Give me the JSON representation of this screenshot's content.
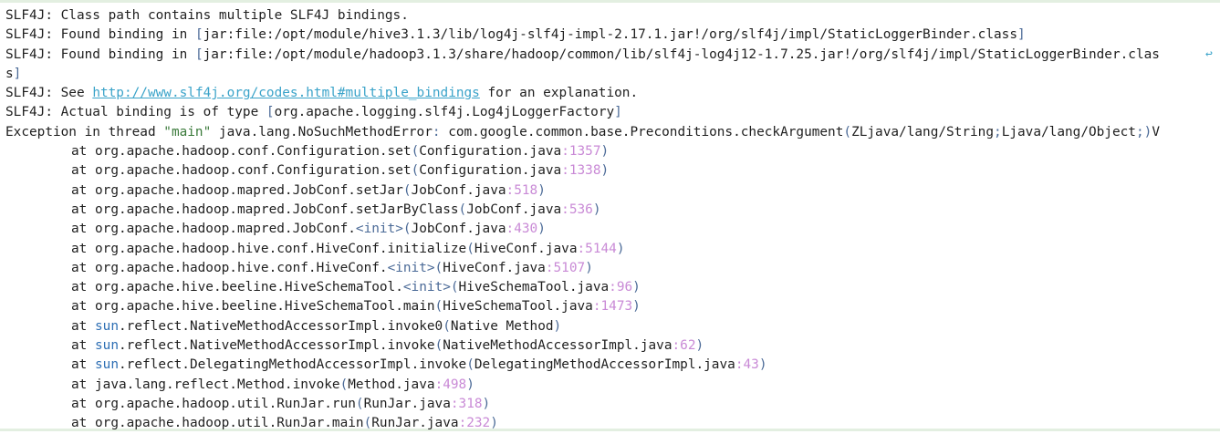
{
  "console": {
    "lines": [
      {
        "segments": [
          {
            "t": "SLF4J: Class path contains multiple SLF4J bindings.",
            "c": ""
          }
        ]
      },
      {
        "segments": [
          {
            "t": "SLF4J: Found binding in ",
            "c": ""
          },
          {
            "t": "[",
            "c": "c-dim"
          },
          {
            "t": "jar:file:/opt/module/hive3.1.3/lib/log4j-slf4j-impl-2.17.1.jar!/org/slf4j/impl/StaticLoggerBinder.class",
            "c": ""
          },
          {
            "t": "]",
            "c": "c-dim"
          }
        ]
      },
      {
        "segments": [
          {
            "t": "SLF4J: Found binding in ",
            "c": ""
          },
          {
            "t": "[",
            "c": "c-dim"
          },
          {
            "t": "jar:file:/opt/module/hadoop3.1.3/share/hadoop/common/lib/slf4j-log4j12-1.7.25.jar!/org/slf4j/impl/StaticLoggerBinder.clas",
            "c": ""
          }
        ]
      },
      {
        "segments": [
          {
            "t": "s",
            "c": ""
          },
          {
            "t": "]",
            "c": "c-dim"
          }
        ]
      },
      {
        "segments": [
          {
            "t": "SLF4J: See ",
            "c": ""
          },
          {
            "t": "http://www.slf4j.org/codes.html#multiple_bindings",
            "c": "c-link"
          },
          {
            "t": " for an explanation.",
            "c": ""
          }
        ]
      },
      {
        "segments": [
          {
            "t": "SLF4J: Actual binding is of type ",
            "c": ""
          },
          {
            "t": "[",
            "c": "c-dim"
          },
          {
            "t": "org.apache.logging.slf4j.Log4jLoggerFactory",
            "c": ""
          },
          {
            "t": "]",
            "c": "c-dim"
          }
        ]
      },
      {
        "segments": [
          {
            "t": "Exception in thread ",
            "c": ""
          },
          {
            "t": "\"main\"",
            "c": "c-str"
          },
          {
            "t": " java.lang.NoSuchMethodError",
            "c": ""
          },
          {
            "t": ":",
            "c": "c-dim"
          },
          {
            "t": " com.google.common.base.Preconditions.checkArgument",
            "c": ""
          },
          {
            "t": "(",
            "c": "c-dim"
          },
          {
            "t": "ZLjava/lang/String",
            "c": ""
          },
          {
            "t": ";",
            "c": "c-dim"
          },
          {
            "t": "Ljava/lang/Object",
            "c": ""
          },
          {
            "t": ";",
            "c": "c-dim"
          },
          {
            "t": ")",
            "c": "c-dim"
          },
          {
            "t": "V",
            "c": ""
          }
        ]
      },
      {
        "indent": true,
        "segments": [
          {
            "t": "at org.apache.hadoop.conf.Configuration.set",
            "c": ""
          },
          {
            "t": "(",
            "c": "c-dim"
          },
          {
            "t": "Configuration.java",
            "c": ""
          },
          {
            "t": ":1357",
            "c": "c-num"
          },
          {
            "t": ")",
            "c": "c-dim"
          }
        ]
      },
      {
        "indent": true,
        "segments": [
          {
            "t": "at org.apache.hadoop.conf.Configuration.set",
            "c": ""
          },
          {
            "t": "(",
            "c": "c-dim"
          },
          {
            "t": "Configuration.java",
            "c": ""
          },
          {
            "t": ":1338",
            "c": "c-num"
          },
          {
            "t": ")",
            "c": "c-dim"
          }
        ]
      },
      {
        "indent": true,
        "segments": [
          {
            "t": "at org.apache.hadoop.mapred.JobConf.setJar",
            "c": ""
          },
          {
            "t": "(",
            "c": "c-dim"
          },
          {
            "t": "JobConf.java",
            "c": ""
          },
          {
            "t": ":518",
            "c": "c-num"
          },
          {
            "t": ")",
            "c": "c-dim"
          }
        ]
      },
      {
        "indent": true,
        "segments": [
          {
            "t": "at org.apache.hadoop.mapred.JobConf.setJarByClass",
            "c": ""
          },
          {
            "t": "(",
            "c": "c-dim"
          },
          {
            "t": "JobConf.java",
            "c": ""
          },
          {
            "t": ":536",
            "c": "c-num"
          },
          {
            "t": ")",
            "c": "c-dim"
          }
        ]
      },
      {
        "indent": true,
        "segments": [
          {
            "t": "at org.apache.hadoop.mapred.JobConf.",
            "c": ""
          },
          {
            "t": "<init>",
            "c": "c-dim"
          },
          {
            "t": "(",
            "c": "c-dim"
          },
          {
            "t": "JobConf.java",
            "c": ""
          },
          {
            "t": ":430",
            "c": "c-num"
          },
          {
            "t": ")",
            "c": "c-dim"
          }
        ]
      },
      {
        "indent": true,
        "segments": [
          {
            "t": "at org.apache.hadoop.hive.conf.HiveConf.initialize",
            "c": ""
          },
          {
            "t": "(",
            "c": "c-dim"
          },
          {
            "t": "HiveConf.java",
            "c": ""
          },
          {
            "t": ":5144",
            "c": "c-num"
          },
          {
            "t": ")",
            "c": "c-dim"
          }
        ]
      },
      {
        "indent": true,
        "segments": [
          {
            "t": "at org.apache.hadoop.hive.conf.HiveConf.",
            "c": ""
          },
          {
            "t": "<init>",
            "c": "c-dim"
          },
          {
            "t": "(",
            "c": "c-dim"
          },
          {
            "t": "HiveConf.java",
            "c": ""
          },
          {
            "t": ":5107",
            "c": "c-num"
          },
          {
            "t": ")",
            "c": "c-dim"
          }
        ]
      },
      {
        "indent": true,
        "segments": [
          {
            "t": "at org.apache.hive.beeline.HiveSchemaTool.",
            "c": ""
          },
          {
            "t": "<init>",
            "c": "c-dim"
          },
          {
            "t": "(",
            "c": "c-dim"
          },
          {
            "t": "HiveSchemaTool.java",
            "c": ""
          },
          {
            "t": ":96",
            "c": "c-num"
          },
          {
            "t": ")",
            "c": "c-dim"
          }
        ]
      },
      {
        "indent": true,
        "segments": [
          {
            "t": "at org.apache.hive.beeline.HiveSchemaTool.main",
            "c": ""
          },
          {
            "t": "(",
            "c": "c-dim"
          },
          {
            "t": "HiveSchemaTool.java",
            "c": ""
          },
          {
            "t": ":1473",
            "c": "c-num"
          },
          {
            "t": ")",
            "c": "c-dim"
          }
        ]
      },
      {
        "indent": true,
        "segments": [
          {
            "t": "at ",
            "c": ""
          },
          {
            "t": "sun",
            "c": "c-pkg"
          },
          {
            "t": ".reflect.NativeMethodAccessorImpl.invoke0",
            "c": ""
          },
          {
            "t": "(",
            "c": "c-dim"
          },
          {
            "t": "Native Method",
            "c": ""
          },
          {
            "t": ")",
            "c": "c-dim"
          }
        ]
      },
      {
        "indent": true,
        "segments": [
          {
            "t": "at ",
            "c": ""
          },
          {
            "t": "sun",
            "c": "c-pkg"
          },
          {
            "t": ".reflect.NativeMethodAccessorImpl.invoke",
            "c": ""
          },
          {
            "t": "(",
            "c": "c-dim"
          },
          {
            "t": "NativeMethodAccessorImpl.java",
            "c": ""
          },
          {
            "t": ":62",
            "c": "c-num"
          },
          {
            "t": ")",
            "c": "c-dim"
          }
        ]
      },
      {
        "indent": true,
        "segments": [
          {
            "t": "at ",
            "c": ""
          },
          {
            "t": "sun",
            "c": "c-pkg"
          },
          {
            "t": ".reflect.DelegatingMethodAccessorImpl.invoke",
            "c": ""
          },
          {
            "t": "(",
            "c": "c-dim"
          },
          {
            "t": "DelegatingMethodAccessorImpl.java",
            "c": ""
          },
          {
            "t": ":43",
            "c": "c-num"
          },
          {
            "t": ")",
            "c": "c-dim"
          }
        ]
      },
      {
        "indent": true,
        "segments": [
          {
            "t": "at java.lang.reflect.Method.invoke",
            "c": ""
          },
          {
            "t": "(",
            "c": "c-dim"
          },
          {
            "t": "Method.java",
            "c": ""
          },
          {
            "t": ":498",
            "c": "c-num"
          },
          {
            "t": ")",
            "c": "c-dim"
          }
        ]
      },
      {
        "indent": true,
        "segments": [
          {
            "t": "at org.apache.hadoop.util.RunJar.run",
            "c": ""
          },
          {
            "t": "(",
            "c": "c-dim"
          },
          {
            "t": "RunJar.java",
            "c": ""
          },
          {
            "t": ":318",
            "c": "c-num"
          },
          {
            "t": ")",
            "c": "c-dim"
          }
        ]
      },
      {
        "indent": true,
        "segments": [
          {
            "t": "at org.apache.hadoop.util.RunJar.main",
            "c": ""
          },
          {
            "t": "(",
            "c": "c-dim"
          },
          {
            "t": "RunJar.java",
            "c": ""
          },
          {
            "t": ":232",
            "c": "c-num"
          },
          {
            "t": ")",
            "c": "c-dim"
          }
        ]
      }
    ],
    "wrap_icon": "soft-wrap-icon"
  }
}
